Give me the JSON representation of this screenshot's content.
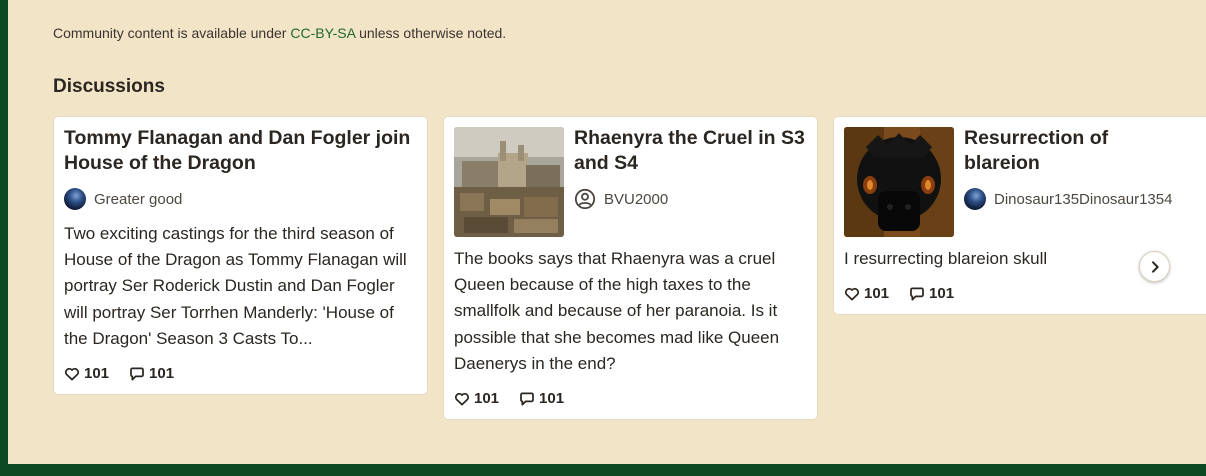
{
  "footer": {
    "license_prefix": "Community content is available under ",
    "license_link": "CC-BY-SA",
    "license_suffix": " unless otherwise noted."
  },
  "discussions": {
    "heading": "Discussions",
    "cards": [
      {
        "title": "Tommy Flanagan and Dan Fogler join House of the Dragon",
        "author": "Greater good",
        "excerpt": "Two exciting castings for the third season of House of the Dragon as Tommy Flanagan will portray Ser Roderick Dustin and Dan Fogler will portray Ser Torrhen Manderly: 'House of the Dragon' Season 3 Casts To...",
        "likes": "101",
        "comments": "101"
      },
      {
        "title": "Rhaenyra the Cruel in S3 and S4",
        "author": "BVU2000",
        "excerpt": "The books says that Rhaenyra was a cruel Queen because of the high taxes to the smallfolk and because of her paranoia. Is it possible that she becomes mad like Queen Daenerys in the end?",
        "likes": "101",
        "comments": "101"
      },
      {
        "title": "Resurrection of blareion",
        "author": "Dinosaur135Dinosaur1354",
        "excerpt": "I resurrecting blareion skull",
        "likes": "101",
        "comments": "101"
      }
    ]
  },
  "icons": {
    "like": "heart-icon",
    "comment": "comment-bubble-icon",
    "next": "chevron-right-icon",
    "default_avatar": "user-circle-icon"
  },
  "colors": {
    "page_background": "#f2e4c6",
    "frame": "#0c4a23",
    "link": "#1e6a2c",
    "card": "#ffffff"
  }
}
